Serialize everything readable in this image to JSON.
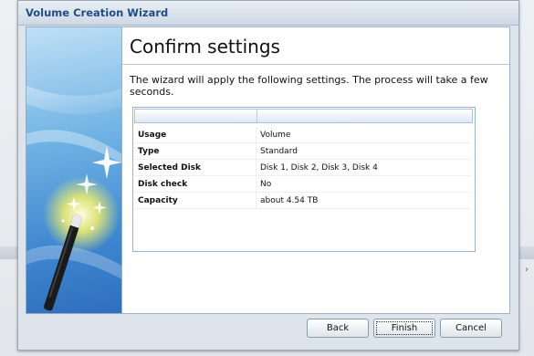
{
  "window": {
    "title": "Volume Creation Wizard"
  },
  "content": {
    "heading": "Confirm settings",
    "description": "The wizard will apply the following settings. The process will take a few seconds."
  },
  "settings_table": {
    "rows": [
      {
        "label": "Usage",
        "value": "Volume"
      },
      {
        "label": "Type",
        "value": "Standard"
      },
      {
        "label": "Selected Disk",
        "value": "Disk 1, Disk 2, Disk 3, Disk 4"
      },
      {
        "label": "Disk check",
        "value": "No"
      },
      {
        "label": "Capacity",
        "value": "about 4.54 TB"
      }
    ]
  },
  "buttons": {
    "back": "Back",
    "finish": "Finish",
    "cancel": "Cancel"
  },
  "icons": {
    "wizard_art": "magic-wand-icon"
  },
  "colors": {
    "title_text": "#1f4e86",
    "panel_blue": "#3e86cf"
  }
}
